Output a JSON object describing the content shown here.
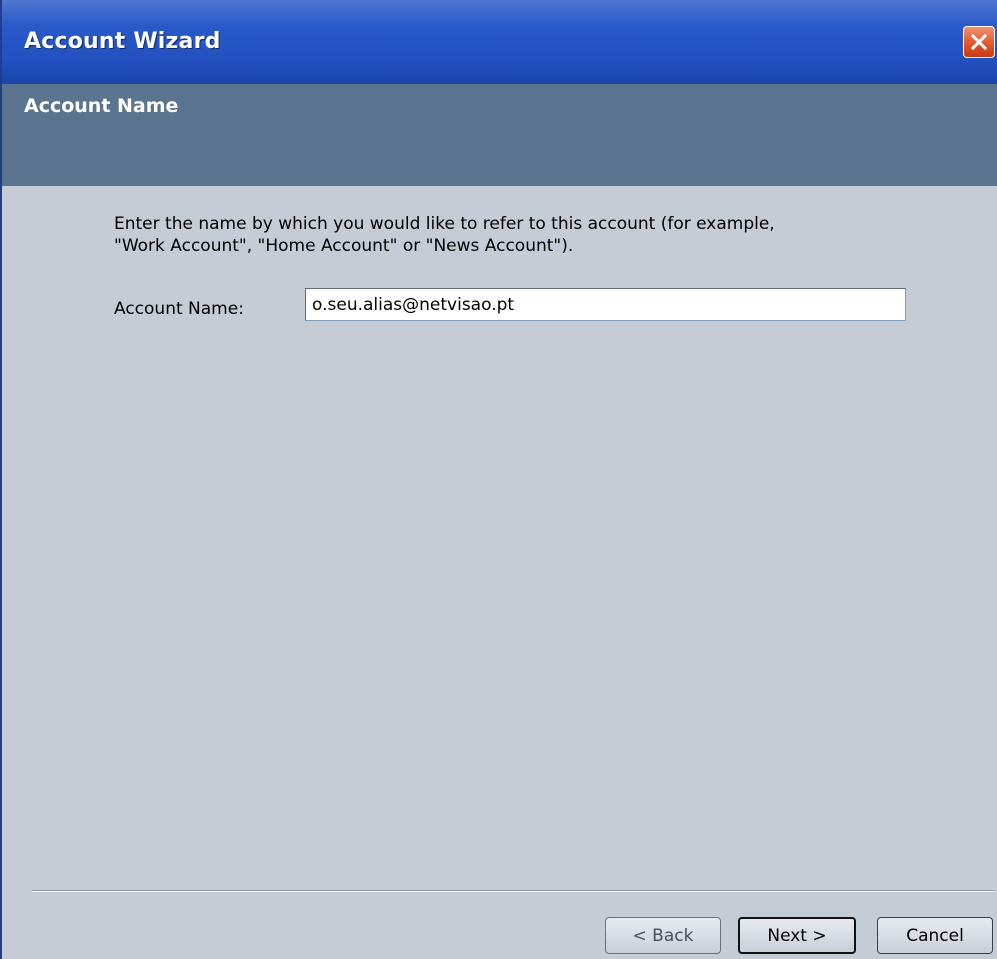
{
  "window": {
    "title": "Account Wizard",
    "close_icon": "close-x-icon",
    "close_color": "#e2562c"
  },
  "header": {
    "title": "Account Name"
  },
  "main": {
    "description_line1": "Enter the name by which you would like to refer to this account (for example,",
    "description_line2": "\"Work Account\", \"Home Account\" or \"News Account\").",
    "field_label": "Account Name:",
    "field_value": "o.seu.alias@netvisao.pt"
  },
  "footer": {
    "back_label": "< Back",
    "next_label": "Next >",
    "cancel_label": "Cancel"
  }
}
